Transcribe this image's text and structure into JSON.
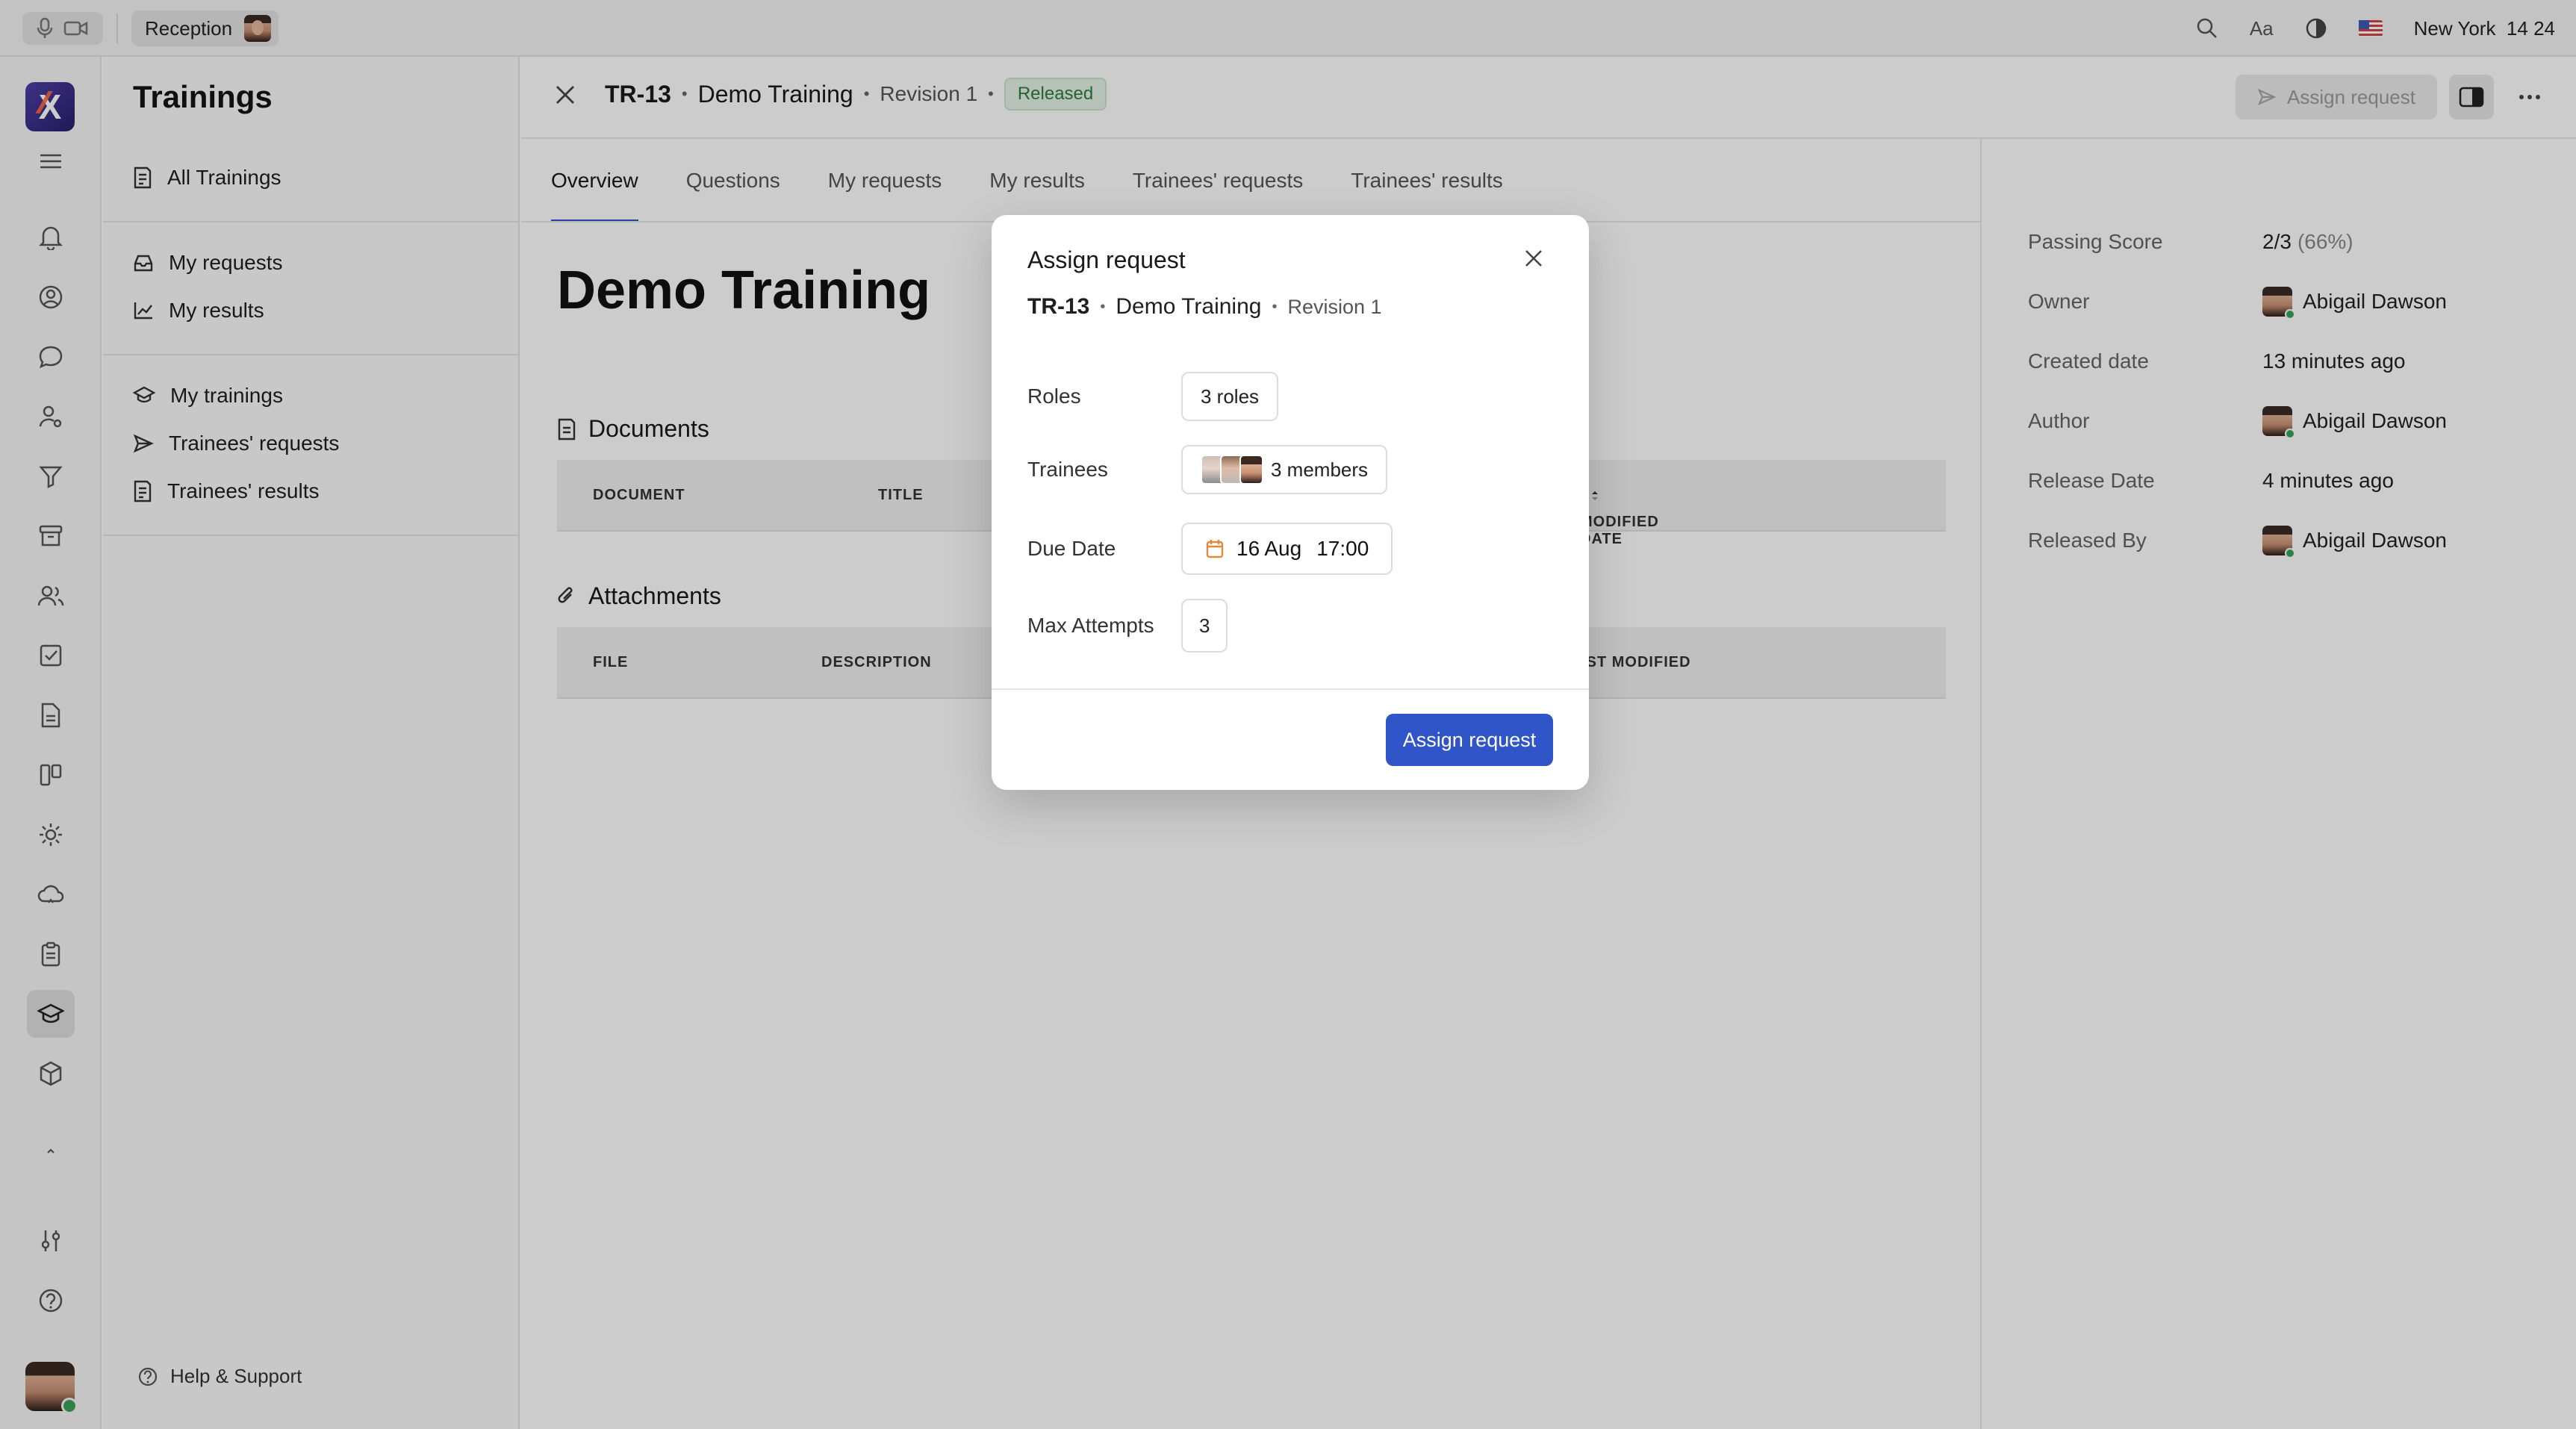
{
  "topbar": {
    "location_label": "Reception",
    "font_label": "Aa",
    "city": "New York",
    "time": "14 24"
  },
  "sidebar": {
    "title": "Trainings",
    "items": [
      {
        "label": "All Trainings",
        "icon": "list-doc-icon"
      },
      {
        "label": "My requests",
        "icon": "inbox-icon"
      },
      {
        "label": "My results",
        "icon": "chart-line-icon"
      },
      {
        "label": "My trainings",
        "icon": "graduation-cap-icon"
      },
      {
        "label": "Trainees' requests",
        "icon": "send-icon"
      },
      {
        "label": "Trainees' results",
        "icon": "list-doc-icon"
      }
    ],
    "help_label": "Help & Support"
  },
  "header": {
    "id": "TR-13",
    "name": "Demo Training",
    "revision": "Revision 1",
    "status": "Released",
    "assign_label": "Assign request"
  },
  "tabs": [
    "Overview",
    "Questions",
    "My requests",
    "My results",
    "Trainees' requests",
    "Trainees' results"
  ],
  "content": {
    "title": "Demo Training",
    "documents": {
      "heading": "Documents",
      "columns": [
        "DOCUMENT",
        "TITLE",
        "MODIFIED DATE"
      ]
    },
    "attachments": {
      "heading": "Attachments",
      "columns": [
        "FILE",
        "DESCRIPTION",
        "LAST MODIFIED"
      ]
    }
  },
  "details": {
    "passing_score_label": "Passing Score",
    "passing_score": "2/3",
    "passing_score_pct": "(66%)",
    "owner_label": "Owner",
    "owner": "Abigail Dawson",
    "created_label": "Created date",
    "created": "13 minutes ago",
    "author_label": "Author",
    "author": "Abigail Dawson",
    "release_date_label": "Release Date",
    "release_date": "4 minutes ago",
    "released_by_label": "Released By",
    "released_by": "Abigail Dawson"
  },
  "modal": {
    "title": "Assign request",
    "id": "TR-13",
    "name": "Demo Training",
    "revision": "Revision 1",
    "roles_label": "Roles",
    "roles_value": "3 roles",
    "trainees_label": "Trainees",
    "trainees_value": "3 members",
    "due_label": "Due Date",
    "due_day": "16 Aug",
    "due_time": "17:00",
    "attempts_label": "Max Attempts",
    "attempts_value": "3",
    "submit_label": "Assign request"
  },
  "colors": {
    "accent": "#2f55c9",
    "released_badge": "#e4f3e6",
    "calendar_icon": "#e08a3a"
  }
}
